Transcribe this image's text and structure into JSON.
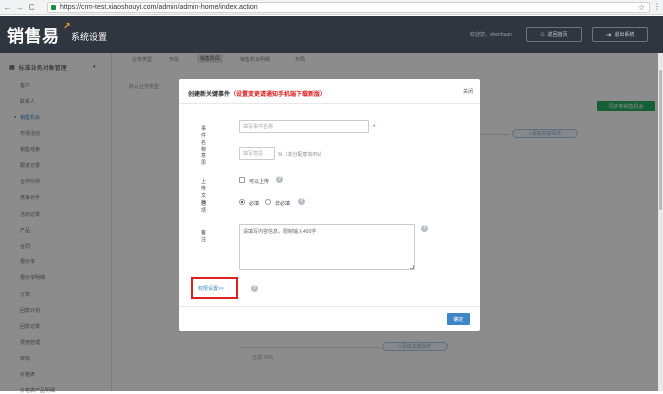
{
  "browser": {
    "back": "←",
    "forward": "→",
    "reload": "C",
    "url": "https://crm-test.xiaoshouyi.com/admin/admin-home/index.action",
    "star": "☆",
    "menu": "⋮"
  },
  "header": {
    "logo": "销售易",
    "logo_mark": "↗",
    "subtitle": "系统设置",
    "welcome": "欢迎您，shenhuan",
    "home_icon": "home-icon",
    "home_label": "返回首页",
    "logout_icon": "logout-icon",
    "logout_label": "退出系统"
  },
  "sidebar": {
    "heading": "标准业务对象管理",
    "heading_icon": "grid-icon",
    "items": [
      {
        "label": "客户"
      },
      {
        "label": "联系人"
      },
      {
        "label": "销售机会",
        "active": true
      },
      {
        "label": "市场活动"
      },
      {
        "label": "销售线索"
      },
      {
        "label": "跟进记录"
      },
      {
        "label": "合作伙伴"
      },
      {
        "label": "竞争对手"
      },
      {
        "label": "活动记录"
      },
      {
        "label": "产品"
      },
      {
        "label": "合同"
      },
      {
        "label": "报价单"
      },
      {
        "label": "报价单明细"
      },
      {
        "label": "订单"
      },
      {
        "label": "回款计划"
      },
      {
        "label": "回款记录"
      },
      {
        "label": "费用管理"
      },
      {
        "label": "目标"
      },
      {
        "label": "价格表"
      },
      {
        "label": "价格表产品明细"
      }
    ]
  },
  "tabs": [
    {
      "label": "业务类型"
    },
    {
      "label": "字段"
    },
    {
      "label": "销售阶段",
      "active": true
    },
    {
      "label": "销售机会明细"
    },
    {
      "label": "布局"
    }
  ],
  "background": {
    "default_type": "默认业务类型",
    "sync_button": "同步到销售机会",
    "add_key_event": "+添加关键事件",
    "add_key_event_2": "+添加关键事件",
    "stage_text": "五期  30%"
  },
  "modal": {
    "title": "创建新关键事件",
    "title_note": "（设置变更请通知手机端下载新版）",
    "close": "关闭",
    "fields": {
      "name_label": "事件名称",
      "name_placeholder": "填写事件名称",
      "required_mark": "*",
      "weight_label": "意思",
      "weight_placeholder": "填写意思",
      "weight_unit": "%（本分配意向0%）",
      "upload_label": "上传文档",
      "upload_option": "可以上传",
      "option_label": "选项",
      "required_option": "必填",
      "optional_option": "非必填",
      "remark_label": "备注",
      "remark_value": "请填写内容信息，限制输入400字"
    },
    "permission_link": "权限设置>>",
    "confirm": "确定"
  }
}
